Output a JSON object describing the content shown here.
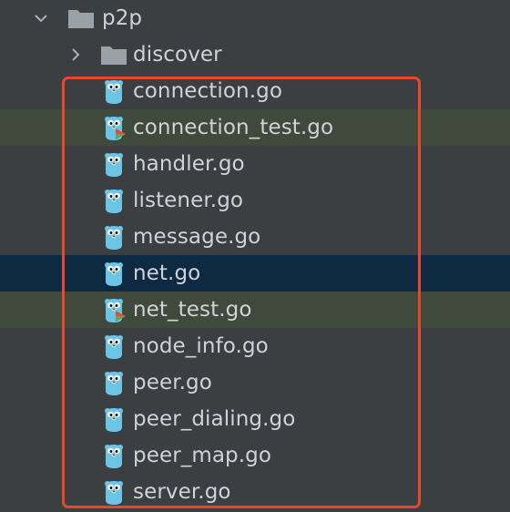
{
  "tree": {
    "root_folder": {
      "label": "p2p",
      "expanded": true,
      "icon": "folder-icon"
    },
    "subfolder": {
      "label": "discover",
      "expanded": false,
      "icon": "folder-icon"
    },
    "files": [
      {
        "label": "connection.go",
        "icon": "go-gopher-icon",
        "is_test": false,
        "selected": false
      },
      {
        "label": "connection_test.go",
        "icon": "go-gopher-test-icon",
        "is_test": true,
        "selected": false
      },
      {
        "label": "handler.go",
        "icon": "go-gopher-icon",
        "is_test": false,
        "selected": false
      },
      {
        "label": "listener.go",
        "icon": "go-gopher-icon",
        "is_test": false,
        "selected": false
      },
      {
        "label": "message.go",
        "icon": "go-gopher-icon",
        "is_test": false,
        "selected": false
      },
      {
        "label": "net.go",
        "icon": "go-gopher-icon",
        "is_test": false,
        "selected": true
      },
      {
        "label": "net_test.go",
        "icon": "go-gopher-test-icon",
        "is_test": true,
        "selected": false
      },
      {
        "label": "node_info.go",
        "icon": "go-gopher-icon",
        "is_test": false,
        "selected": false
      },
      {
        "label": "peer.go",
        "icon": "go-gopher-icon",
        "is_test": false,
        "selected": false
      },
      {
        "label": "peer_dialing.go",
        "icon": "go-gopher-icon",
        "is_test": false,
        "selected": false
      },
      {
        "label": "peer_map.go",
        "icon": "go-gopher-icon",
        "is_test": false,
        "selected": false
      },
      {
        "label": "server.go",
        "icon": "go-gopher-icon",
        "is_test": false,
        "selected": false
      }
    ]
  },
  "colors": {
    "background": "#3c3f41",
    "text": "#cfd3d7",
    "test_row_bg": "#3f4a3c",
    "selected_row_bg": "#0e2a42",
    "highlight_border": "#e8472b",
    "gopher_blue": "#6cc4e6",
    "folder_gray": "#9aa1a7",
    "test_marker_red": "#d9533a",
    "test_marker_green": "#5fa652"
  }
}
